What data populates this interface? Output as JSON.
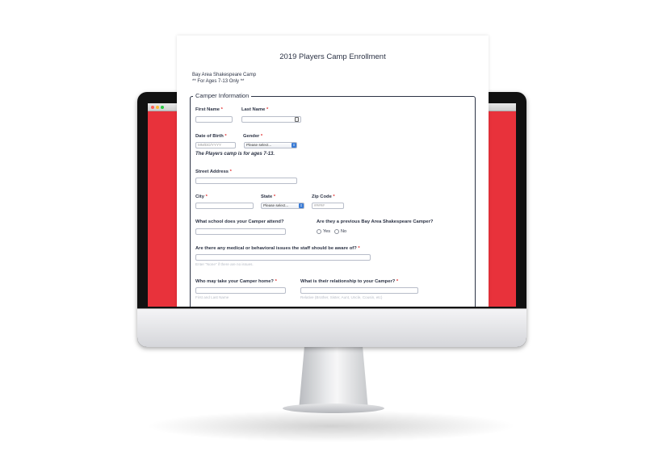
{
  "form": {
    "title": "2019 Players Camp Enrollment",
    "subtitle_line1": "Bay Area Shakespeare Camp",
    "subtitle_line2": "** For Ages 7-13 Only **",
    "section_title": "Camper Information",
    "required_mark": "*",
    "fields": {
      "first_name": "First Name",
      "last_name": "Last Name",
      "dob": "Date of Birth",
      "dob_placeholder": "MM/DD/YYYY",
      "gender": "Gender",
      "gender_value": "Please select...",
      "age_note": "The Players camp is for ages 7-13.",
      "street": "Street Address",
      "city": "City",
      "state": "State",
      "state_value": "Please select...",
      "zip": "Zip Code",
      "zip_placeholder": "#####",
      "school": "What school does your Camper attend?",
      "previous": "Are they a previous Bay Area Shakespeare Camper?",
      "yes": "Yes",
      "no": "No",
      "medical": "Are there any medical or behavioral issues the staff should be aware of?",
      "medical_sub": "Enter \"None\" if there are no issues.",
      "pickup": "Who may take your Camper home?",
      "pickup_sub": "First and Last Name",
      "relationship": "What is their relationship to your Camper?",
      "relationship_sub": "Relative (Brother, Sister, Aunt, Uncle, Cousin, etc)"
    }
  },
  "colors": {
    "accent_red": "#e8323b",
    "text_dark": "#2c3345",
    "select_blue": "#3a7bd5"
  },
  "icons": {
    "dropdown": "chevron-updown-icon",
    "contact_card": "contact-card-icon"
  }
}
